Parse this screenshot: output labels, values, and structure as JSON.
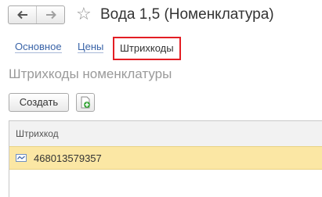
{
  "header": {
    "back_icon": "arrow-left-icon",
    "forward_icon": "arrow-right-icon",
    "favorite_icon": "star-outline-icon",
    "title": "Вода 1,5 (Номенклатура)"
  },
  "tabs": [
    {
      "label": "Основное",
      "active": false
    },
    {
      "label": "Цены",
      "active": false
    },
    {
      "label": "Штрихкоды",
      "active": true
    }
  ],
  "section": {
    "title": "Штрихкоды номенклатуры"
  },
  "toolbar": {
    "create_label": "Создать",
    "add_icon": "add-document-icon"
  },
  "table": {
    "column_header": "Штрихкод",
    "rows": [
      {
        "value": "468013579357",
        "selected": true,
        "icon": "barcode-item-icon"
      }
    ]
  },
  "colors": {
    "active_tab_border": "#e31e24",
    "link": "#3a64a8",
    "selected_row": "#fbe7a4"
  }
}
